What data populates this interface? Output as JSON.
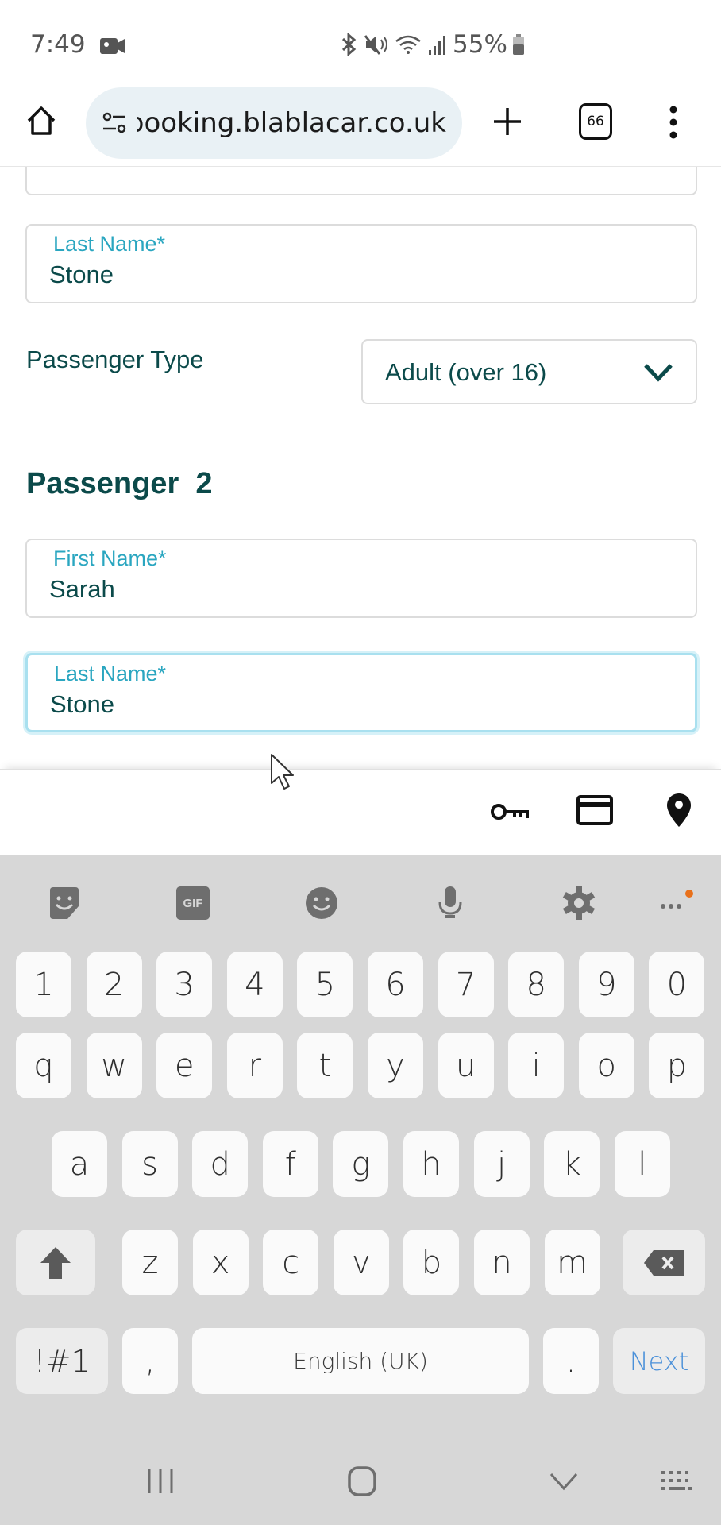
{
  "status_bar": {
    "time": "7:49",
    "battery": "55%",
    "icons": [
      "video-record-icon",
      "bluetooth-icon",
      "mute-icon",
      "wifi-icon",
      "signal-icon",
      "battery-icon"
    ]
  },
  "browser": {
    "url": "booking.blablacar.co.uk",
    "tab_count": "66",
    "icons": {
      "home": "home-icon",
      "site_settings": "site-settings-icon",
      "new_tab": "plus-icon",
      "tabs": "tab-switcher-icon",
      "menu": "more-vert-icon"
    }
  },
  "form": {
    "passenger1": {
      "last_name_label": "Last Name*",
      "last_name_value": "Stone",
      "passenger_type_label": "Passenger Type",
      "passenger_type_value": "Adult (over 16)"
    },
    "passenger2": {
      "heading": "Passenger  2",
      "first_name_label": "First Name*",
      "first_name_value": "Sarah",
      "last_name_label": "Last Name*",
      "last_name_value": "Stone"
    }
  },
  "autofill": {
    "icons": [
      "key-icon",
      "credit-card-icon",
      "location-pin-icon"
    ]
  },
  "keyboard": {
    "toolbar": [
      "sticker-icon",
      "gif-icon",
      "emoji-icon",
      "microphone-icon",
      "settings-icon",
      "more-icon"
    ],
    "gif_label": "GIF",
    "row_numbers": [
      "1",
      "2",
      "3",
      "4",
      "5",
      "6",
      "7",
      "8",
      "9",
      "0"
    ],
    "row1": [
      "q",
      "w",
      "e",
      "r",
      "t",
      "y",
      "u",
      "i",
      "o",
      "p"
    ],
    "row2": [
      "a",
      "s",
      "d",
      "f",
      "g",
      "h",
      "j",
      "k",
      "l"
    ],
    "row3": [
      "z",
      "x",
      "c",
      "v",
      "b",
      "n",
      "m"
    ],
    "symbols_label": "!#1",
    "comma_label": ",",
    "space_label": "English (UK)",
    "period_label": ".",
    "next_label": "Next"
  },
  "colors": {
    "brand_text": "#0b4a4a",
    "label_teal": "#2aa6c0",
    "focus_ring": "#a9e0ef",
    "next_blue": "#4a90d9",
    "notification_dot": "#e8701a"
  }
}
